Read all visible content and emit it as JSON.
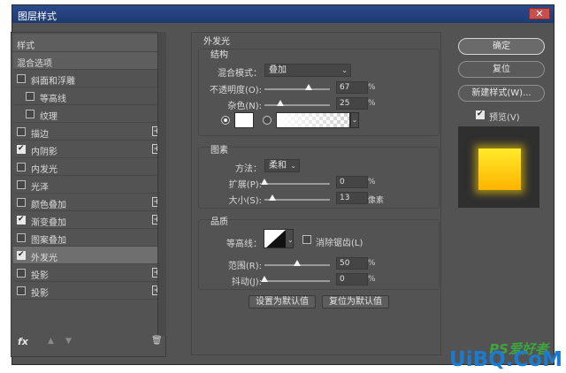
{
  "window": {
    "title": "图层样式",
    "close_icon": "close-icon"
  },
  "left_panel": {
    "header": "样式",
    "blend_options": "混合选项",
    "items": [
      {
        "label": "斜面和浮雕",
        "checked": false,
        "plus": false,
        "indent": false
      },
      {
        "label": "等高线",
        "checked": false,
        "plus": false,
        "indent": true
      },
      {
        "label": "纹理",
        "checked": false,
        "plus": false,
        "indent": true
      },
      {
        "label": "描边",
        "checked": false,
        "plus": true,
        "indent": false
      },
      {
        "label": "内阴影",
        "checked": true,
        "plus": true,
        "indent": false
      },
      {
        "label": "内发光",
        "checked": false,
        "plus": false,
        "indent": false
      },
      {
        "label": "光泽",
        "checked": false,
        "plus": false,
        "indent": false
      },
      {
        "label": "颜色叠加",
        "checked": false,
        "plus": true,
        "indent": false
      },
      {
        "label": "渐变叠加",
        "checked": true,
        "plus": true,
        "indent": false
      },
      {
        "label": "图案叠加",
        "checked": false,
        "plus": false,
        "indent": false
      },
      {
        "label": "外发光",
        "checked": true,
        "plus": false,
        "indent": false,
        "selected": true
      },
      {
        "label": "投影",
        "checked": false,
        "plus": true,
        "indent": false
      },
      {
        "label": "投影",
        "checked": false,
        "plus": true,
        "indent": false
      }
    ],
    "fx_label": "fx"
  },
  "settings": {
    "title": "外发光",
    "structure": {
      "title": "结构",
      "blend_mode_label": "混合模式：",
      "blend_mode_value": "叠加",
      "opacity_label": "不透明度(O):",
      "opacity_value": "67",
      "opacity_unit": "%",
      "noise_label": "杂色(N):",
      "noise_value": "25",
      "noise_unit": "%"
    },
    "elements": {
      "title": "图素",
      "method_label": "方法：",
      "method_value": "柔和",
      "spread_label": "扩展(P):",
      "spread_value": "0",
      "spread_unit": "%",
      "size_label": "大小(S):",
      "size_value": "13",
      "size_unit": "像素"
    },
    "quality": {
      "title": "品质",
      "contour_label": "等高线：",
      "antialias_label": "消除锯齿(L)",
      "range_label": "范围(R):",
      "range_value": "50",
      "range_unit": "%",
      "jitter_label": "抖动(J):",
      "jitter_value": "0",
      "jitter_unit": "%"
    },
    "make_default": "设置为默认值",
    "reset_default": "复位为默认值"
  },
  "actions": {
    "ok": "确定",
    "reset": "复位",
    "new_style": "新建样式(W)...",
    "preview_label": "预览(V)",
    "preview_checked": true
  },
  "watermark": {
    "line1": "PS爱好者",
    "line2": "UiBQ.CoM"
  },
  "colors": {
    "title_bar": "#2b4a8a",
    "panel": "#535353",
    "glow": "#ffd500",
    "watermark_blue": "#1a7bd0"
  }
}
